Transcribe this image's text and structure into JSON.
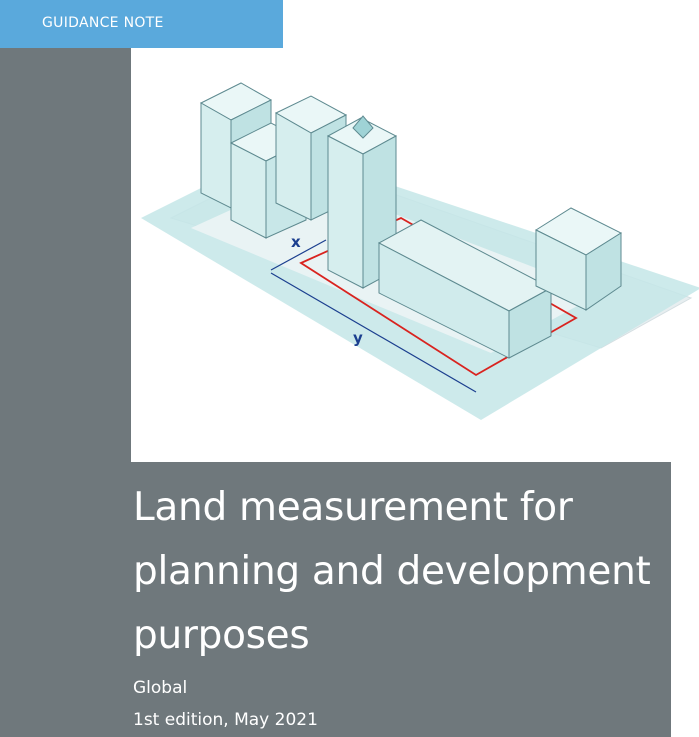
{
  "badge": {
    "label": "GUIDANCE NOTE"
  },
  "cover": {
    "title_lines": [
      "Land measurement for",
      "planning and development",
      "purposes"
    ],
    "region": "Global",
    "edition": "1st edition, May 2021"
  },
  "illustration": {
    "dimension_x": "x",
    "dimension_y": "y"
  },
  "colors": {
    "badge": "#5aa9dc",
    "panel": "#6f787c",
    "building": "#cfeaea",
    "building_edge": "#5e8a90",
    "ground": "#bfe3e4",
    "boundary": "#d9231f",
    "dimension": "#1b3f8f"
  }
}
